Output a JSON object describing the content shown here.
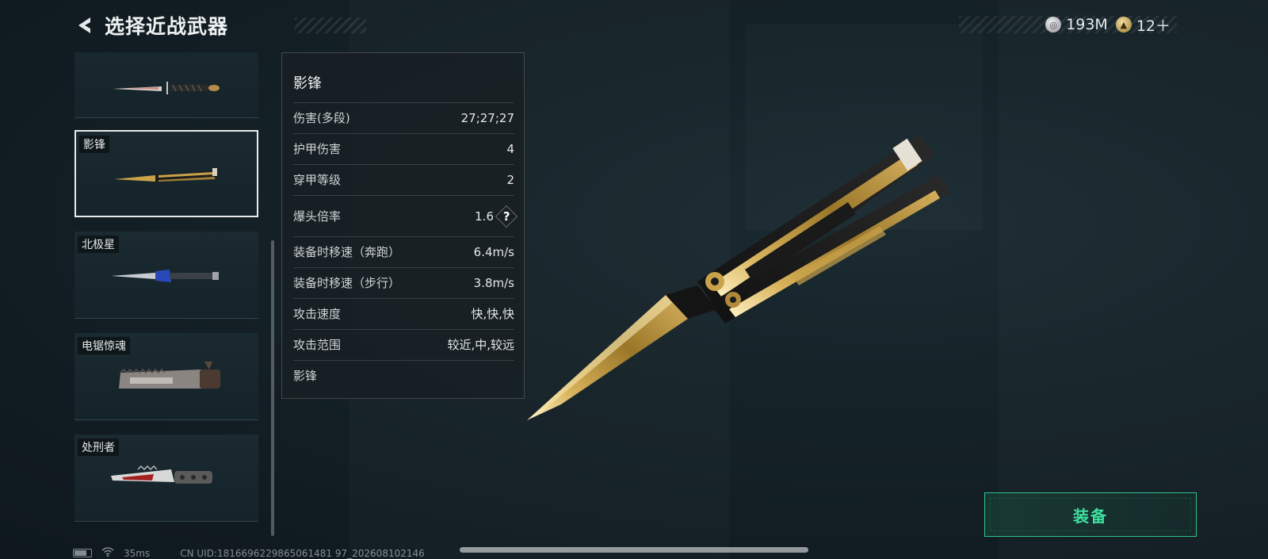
{
  "header": {
    "title": "选择近战武器",
    "currency": [
      {
        "icon": "silver-coin-icon",
        "value": "193M"
      },
      {
        "icon": "gold-coin-icon",
        "value": "12＋"
      }
    ]
  },
  "weapon_list": {
    "items": [
      {
        "name": "",
        "selected": false,
        "icon": "combat-knife-icon"
      },
      {
        "name": "影锋",
        "selected": true,
        "icon": "butterfly-knife-icon"
      },
      {
        "name": "北极星",
        "selected": false,
        "icon": "dagger-icon"
      },
      {
        "name": "电锯惊魂",
        "selected": false,
        "icon": "chainsaw-blade-icon"
      },
      {
        "name": "处刑者",
        "selected": false,
        "icon": "serrated-knife-icon"
      }
    ]
  },
  "stats": {
    "title": "影锋",
    "rows": [
      {
        "label": "伤害(多段)",
        "value": "27;27;27"
      },
      {
        "label": "护甲伤害",
        "value": "4"
      },
      {
        "label": "穿甲等级",
        "value": "2"
      },
      {
        "label": "爆头倍率",
        "value": "1.6",
        "help": "?"
      },
      {
        "label": "装备时移速（奔跑）",
        "value": "6.4m/s"
      },
      {
        "label": "装备时移速（步行）",
        "value": "3.8m/s"
      },
      {
        "label": "攻击速度",
        "value": "快,快,快"
      },
      {
        "label": "攻击范围",
        "value": "较近,中,较远"
      }
    ],
    "footer": "影锋"
  },
  "equip_button": {
    "label": "装备"
  },
  "status_bar": {
    "ping": "35ms",
    "uid": "CN UID:1816696229865061481 97_202608102146"
  },
  "colors": {
    "accent_green": "#31c48d",
    "background": "#142127",
    "gold": "#c9a24a"
  }
}
